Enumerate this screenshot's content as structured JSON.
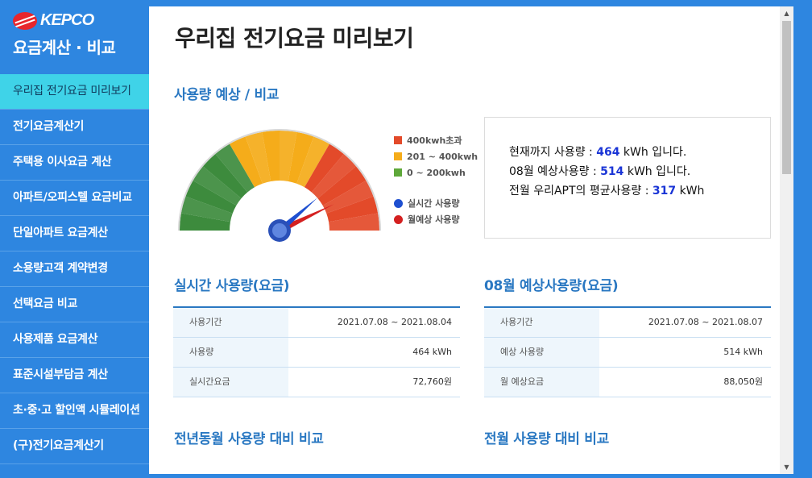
{
  "brand": {
    "logo_text": "KEPCO",
    "app_name": "요금계산 · 비교"
  },
  "sidebar": {
    "items": [
      {
        "label": "우리집 전기요금 미리보기",
        "active": true
      },
      {
        "label": "전기요금계산기"
      },
      {
        "label": "주택용 이사요금 계산"
      },
      {
        "label": "아파트/오피스텔 요금비교"
      },
      {
        "label": "단일아파트 요금계산"
      },
      {
        "label": "소용량고객 계약변경"
      },
      {
        "label": "선택요금 비교"
      },
      {
        "label": "사용제품 요금계산"
      },
      {
        "label": "표준시설부담금 계산"
      },
      {
        "label": "초·중·고 할인액 시뮬레이션"
      },
      {
        "label": "(구)전기요금계산기"
      }
    ]
  },
  "main": {
    "page_title": "우리집 전기요금 미리보기",
    "section_usage": "사용량 예상 / 비교",
    "legend": {
      "over400": "400kwh초과",
      "mid": "201 ~ 400kwh",
      "low": "0 ~ 200kwh",
      "realtime": "실시간 사용량",
      "monthly": "월예상 사용량"
    },
    "summary": {
      "line1_prefix": "현재까지 사용량 : ",
      "line1_value": "464",
      "line1_suffix": " kWh 입니다.",
      "line2_prefix": "08월 예상사용량 : ",
      "line2_value": "514",
      "line2_suffix": " kWh 입니다.",
      "line3_prefix": "전월 우리APT의 평균사용량 : ",
      "line3_value": "317",
      "line3_suffix": " kWh"
    },
    "realtime": {
      "title": "실시간 사용량(요금)",
      "rows": [
        {
          "k": "사용기간",
          "v": "2021.07.08 ~ 2021.08.04"
        },
        {
          "k": "사용량",
          "v": "464 kWh"
        },
        {
          "k": "실시간요금",
          "v": "72,760원"
        }
      ]
    },
    "forecast": {
      "title": "08월 예상사용량(요금)",
      "rows": [
        {
          "k": "사용기간",
          "v": "2021.07.08 ~ 2021.08.07"
        },
        {
          "k": "예상 사용량",
          "v": "514 kWh"
        },
        {
          "k": "월 예상요금",
          "v": "88,050원"
        }
      ]
    },
    "section_yoy": "전년동월 사용량 대비 비교",
    "section_mom": "전월 사용량 대비 비교"
  },
  "gauge": {
    "realtime_kwh": 464,
    "forecast_kwh": 514,
    "max_kwh": 600,
    "colors": {
      "low": "#3d8b3d",
      "mid": "#f5ac1a",
      "high": "#e34a2a",
      "realtime": "#1e4fd0",
      "monthly": "#d42020"
    }
  }
}
